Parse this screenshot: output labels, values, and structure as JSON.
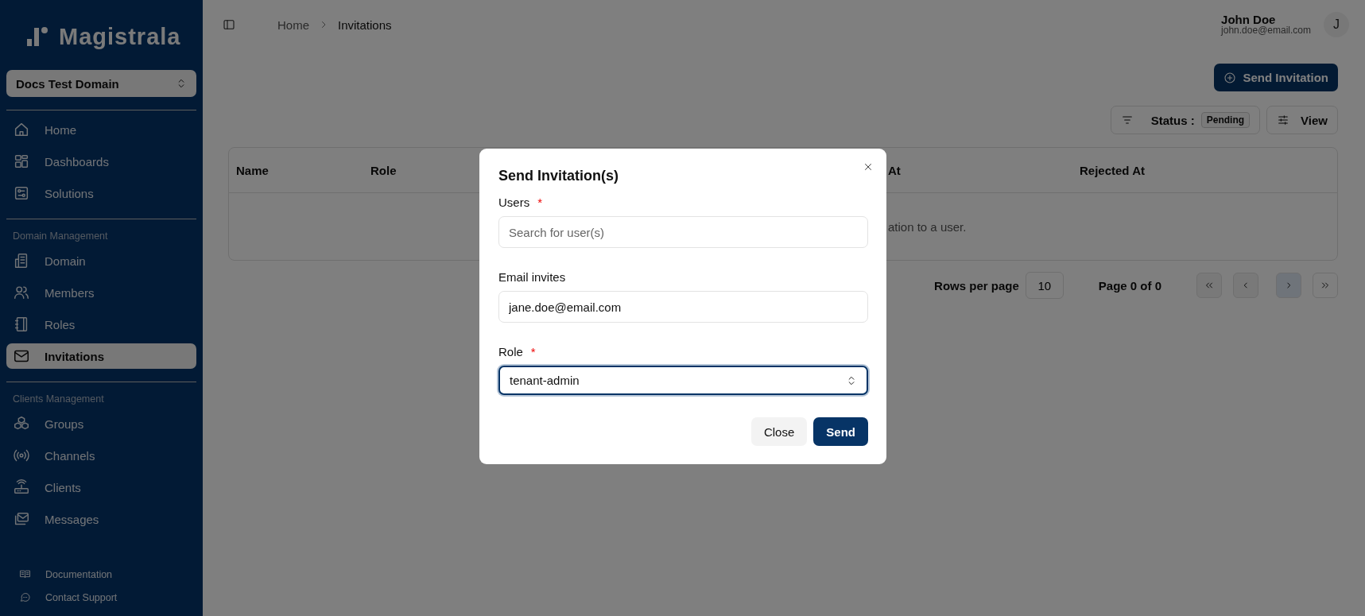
{
  "sidebar": {
    "logo": "Magistrala",
    "domain": "Docs Test Domain",
    "sections": [
      {
        "items": [
          {
            "label": "Home",
            "selected": false
          },
          {
            "label": "Dashboards",
            "selected": false
          },
          {
            "label": "Solutions",
            "selected": false
          }
        ]
      },
      {
        "heading": "Domain Management",
        "items": [
          {
            "label": "Domain",
            "selected": false
          },
          {
            "label": "Members",
            "selected": false
          },
          {
            "label": "Roles",
            "selected": false
          },
          {
            "label": "Invitations",
            "selected": true
          }
        ]
      },
      {
        "heading": "Clients Management",
        "items": [
          {
            "label": "Groups",
            "selected": false
          },
          {
            "label": "Channels",
            "selected": false
          },
          {
            "label": "Clients",
            "selected": false
          },
          {
            "label": "Messages",
            "selected": false
          }
        ]
      }
    ],
    "footer_links": [
      "Documentation",
      "Contact Support"
    ]
  },
  "header": {
    "breadcrumb": [
      "Home",
      "Invitations"
    ],
    "user": {
      "name": "John Doe",
      "email": "john.doe@email.com",
      "initial": "J"
    }
  },
  "toolbar": {
    "primary_button": "Send Invitation",
    "filter": {
      "label": "Status :",
      "value": "Pending"
    },
    "view_button": "View"
  },
  "table": {
    "columns": [
      {
        "label": "Name"
      },
      {
        "label": "Role"
      },
      {
        "label": "At"
      },
      {
        "label": "Rejected At"
      }
    ],
    "empty_text": "ation to a user."
  },
  "pagination": {
    "rows_label": "Rows per page",
    "rows_value": "10",
    "page_text": "Page 0 of 0"
  },
  "dialog": {
    "title": "Send Invitation(s)",
    "fields": [
      {
        "kind": "search",
        "label": "Users",
        "required_mark": "*",
        "placeholder": "Search for user(s)"
      },
      {
        "kind": "text",
        "label": "Email invites",
        "value": "jane.doe@email.com"
      },
      {
        "kind": "select",
        "label": "Role",
        "required_mark": "*",
        "value": "tenant-admin",
        "focused": true
      }
    ],
    "buttons": [
      {
        "label": "Close",
        "kind": "secondary"
      },
      {
        "label": "Send",
        "kind": "primary"
      }
    ]
  }
}
